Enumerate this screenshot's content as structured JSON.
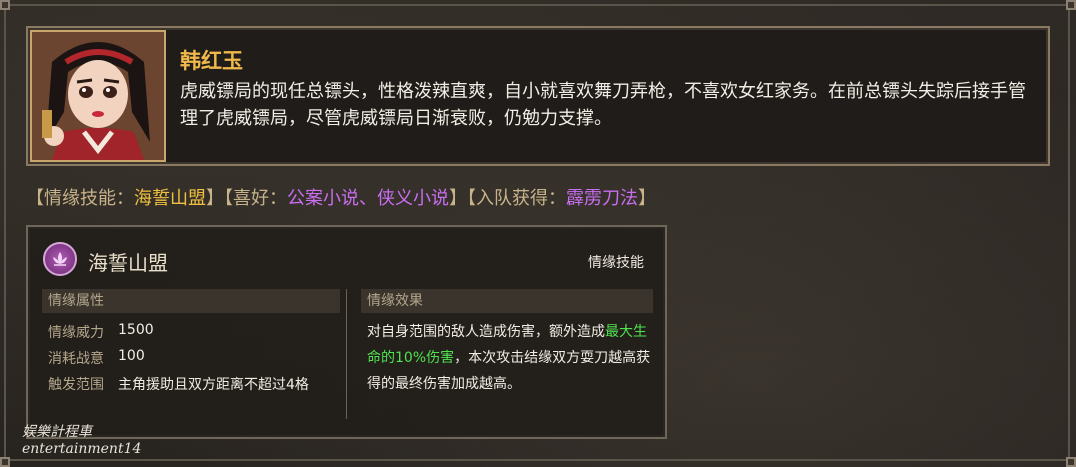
{
  "character": {
    "name": "韩红玉",
    "description": "虎威镖局的现任总镖头，性格泼辣直爽，自小就喜欢舞刀弄枪，不喜欢女红家务。在前总镖头失踪后接手管理了虎威镖局，尽管虎威镖局日渐衰败，仍勉力支撑。",
    "portrait_icon": "character-portrait"
  },
  "info": {
    "skill_prefix": "【情缘技能：",
    "skill_value": "海誓山盟",
    "hobby_prefix": "】【喜好：",
    "hobby_value": "公案小说、侠义小说",
    "reward_prefix": "】【入队获得：",
    "reward_value": "霹雳刀法",
    "suffix": "】"
  },
  "skill": {
    "name": "海誓山盟",
    "type": "情缘技能",
    "attr_header": "情缘属性",
    "effect_header": "情缘效果",
    "attrs": [
      {
        "label": "情缘威力",
        "value": "1500"
      },
      {
        "label": "消耗战意",
        "value": "100"
      },
      {
        "label": "触发范围",
        "value": "主角援助且双方距离不超过4格"
      }
    ],
    "effect_part1": "对自身范围的敌人造成伤害，额外造成",
    "effect_highlight": "最大生命的10%伤害",
    "effect_part2": "，本次攻击结缘双方耍刀越高获得的最终伤害加成越高。"
  },
  "watermark": {
    "line1": "娱樂計程車",
    "line2": "entertainment14"
  },
  "colors": {
    "name": "#f0b84a",
    "gold_value": "#f0c040",
    "purple_value": "#c86ef0",
    "green_highlight": "#4fe34f"
  }
}
